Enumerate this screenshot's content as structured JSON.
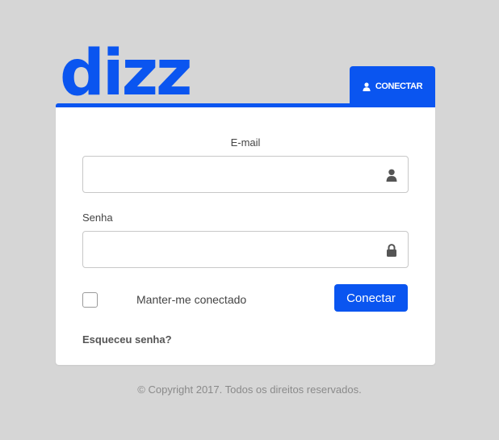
{
  "brand": {
    "logo_text": "dizz",
    "color": "#0a55f0"
  },
  "tab": {
    "label": "CONECTAR",
    "icon": "user-icon"
  },
  "form": {
    "email_label": "E-mail",
    "email_value": "",
    "email_icon": "user-icon",
    "password_label": "Senha",
    "password_value": "",
    "password_icon": "lock-icon",
    "remember_label": "Manter-me conectado",
    "remember_checked": false,
    "submit_label": "Conectar",
    "forgot_label": "Esqueceu senha?"
  },
  "footer": {
    "copyright": "© Copyright 2017. Todos os direitos reservados."
  }
}
